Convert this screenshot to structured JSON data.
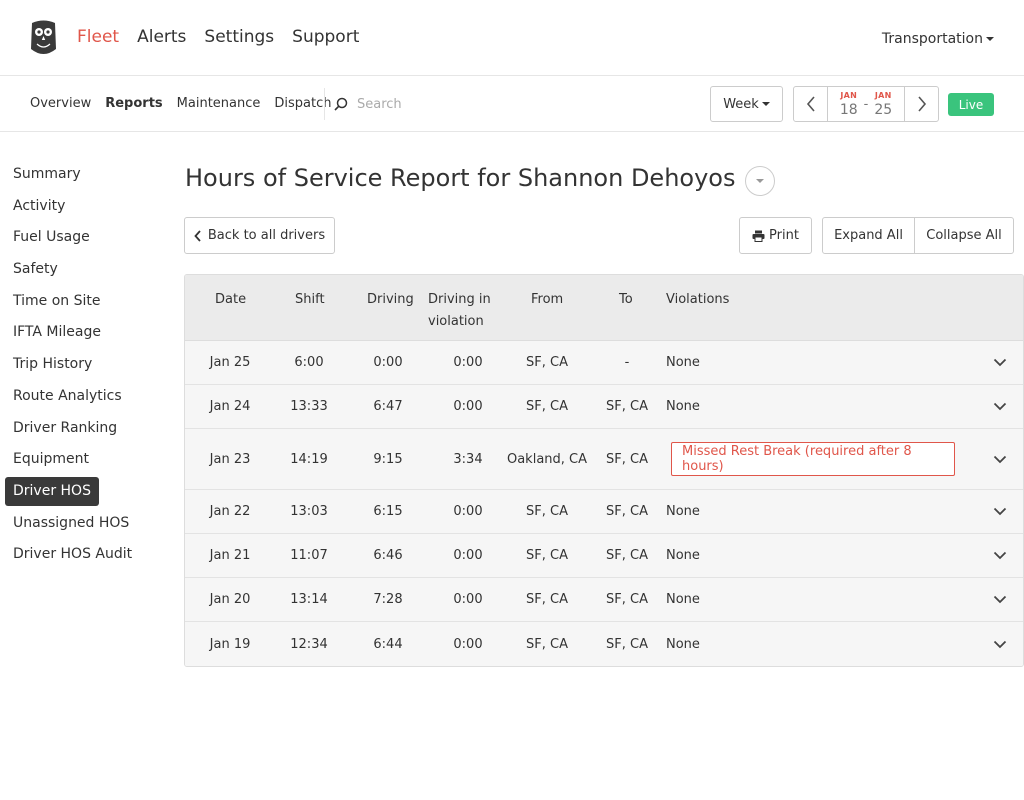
{
  "topnav": {
    "items": [
      "Fleet",
      "Alerts",
      "Settings",
      "Support"
    ],
    "active": "Fleet",
    "org": "Transportation"
  },
  "subnav": {
    "items": [
      "Overview",
      "Reports",
      "Maintenance",
      "Dispatch"
    ],
    "active": "Reports",
    "search_placeholder": "Search",
    "period": "Week",
    "start": {
      "month": "JAN",
      "day": "18"
    },
    "end": {
      "month": "JAN",
      "day": "25"
    },
    "range_sep": "-",
    "live": "Live"
  },
  "sidebar": {
    "items": [
      "Summary",
      "Activity",
      "Fuel Usage",
      "Safety",
      "Time on Site",
      "IFTA Mileage",
      "Trip History",
      "Route Analytics",
      "Driver Ranking",
      "Equipment",
      "Driver HOS",
      "Unassigned HOS",
      "Driver HOS Audit"
    ],
    "active": "Driver HOS"
  },
  "main": {
    "title": "Hours of Service Report for Shannon Dehoyos",
    "back_label": "Back to all drivers",
    "print_label": "Print",
    "expand_label": "Expand All",
    "collapse_label": "Collapse All"
  },
  "table": {
    "headers": {
      "date": "Date",
      "shift": "Shift",
      "driving": "Driving",
      "driving_violation_1": "Driving in",
      "driving_violation_2": "violation",
      "from": "From",
      "to": "To",
      "violations": "Violations"
    },
    "rows": [
      {
        "date": "Jan 25",
        "shift": "6:00",
        "driving": "0:00",
        "in_violation": "0:00",
        "from": "SF, CA",
        "to": "-",
        "violations": "None",
        "flagged": false
      },
      {
        "date": "Jan 24",
        "shift": "13:33",
        "driving": "6:47",
        "in_violation": "0:00",
        "from": "SF, CA",
        "to": "SF, CA",
        "violations": "None",
        "flagged": false
      },
      {
        "date": "Jan 23",
        "shift": "14:19",
        "driving": "9:15",
        "in_violation": "3:34",
        "from": "Oakland, CA",
        "to": "SF, CA",
        "violations": "Missed Rest Break (required after 8 hours)",
        "flagged": true
      },
      {
        "date": "Jan 22",
        "shift": "13:03",
        "driving": "6:15",
        "in_violation": "0:00",
        "from": "SF, CA",
        "to": "SF, CA",
        "violations": "None",
        "flagged": false
      },
      {
        "date": "Jan 21",
        "shift": "11:07",
        "driving": "6:46",
        "in_violation": "0:00",
        "from": "SF, CA",
        "to": "SF, CA",
        "violations": "None",
        "flagged": false
      },
      {
        "date": "Jan 20",
        "shift": "13:14",
        "driving": "7:28",
        "in_violation": "0:00",
        "from": "SF, CA",
        "to": "SF, CA",
        "violations": "None",
        "flagged": false
      },
      {
        "date": "Jan 19",
        "shift": "12:34",
        "driving": "6:44",
        "in_violation": "0:00",
        "from": "SF, CA",
        "to": "SF, CA",
        "violations": "None",
        "flagged": false
      }
    ]
  },
  "colors": {
    "accent": "#e0564a",
    "live": "#3ac47d",
    "active_sidebar": "#3a3a3a"
  }
}
